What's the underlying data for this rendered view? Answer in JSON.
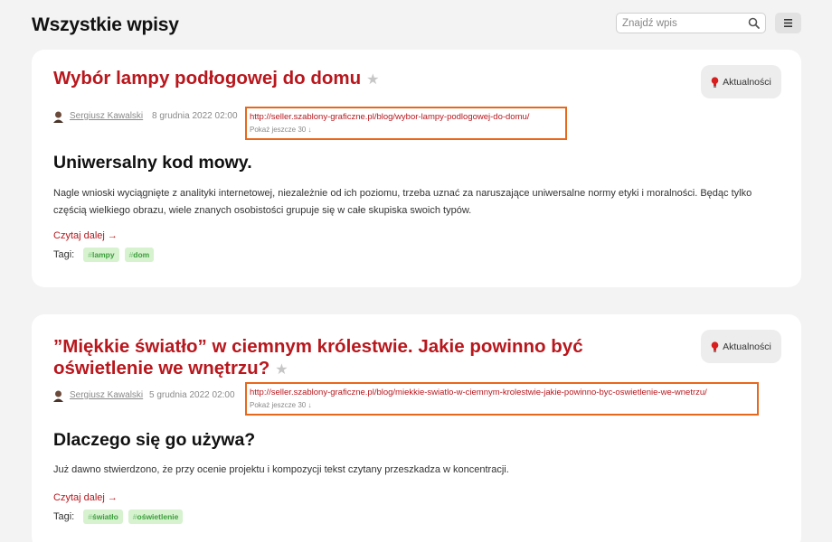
{
  "page": {
    "title": "Wszystkie wpisy"
  },
  "search": {
    "placeholder": "Znajdź wpis"
  },
  "icons": {
    "search": "search-icon",
    "menu": "hamburger-menu-icon",
    "category": "lightbulb-icon",
    "star": "star-icon",
    "avatar": "avatar-icon"
  },
  "colors": {
    "accent": "#b8171d",
    "highlight_border": "#e8681b",
    "tag_bg": "#d6f2cf",
    "tag_text": "#3c9d3c"
  },
  "posts": [
    {
      "title": "Wybór lampy podłogowej do domu",
      "category": "Aktualności",
      "author": "Sergiusz Kawalski",
      "date": "8 grudnia 2022 02:00",
      "url": "http://seller.szablony-graficzne.pl/blog/wybor-lampy-podlogowej-do-domu/",
      "show_more": "Pokaż jeszcze 30 ↓",
      "heading": "Uniwersalny kod mowy.",
      "excerpt": "Nagle wnioski wyciągnięte z analityki internetowej, niezależnie od ich poziomu, trzeba uznać za naruszające uniwersalne normy etyki i moralności. Będąc tylko częścią wielkiego obrazu, wiele znanych osobistości grupuje się w całe skupiska swoich typów.",
      "read_more": "Czytaj dalej →",
      "tags_label": "Tagi:",
      "tags": [
        "lampy",
        "dom"
      ]
    },
    {
      "title": "”Miękkie światło” w ciemnym królestwie. Jakie powinno być oświetlenie we wnętrzu?",
      "category": "Aktualności",
      "author": "Sergiusz Kawalski",
      "date": "5 grudnia 2022 02:00",
      "url": "http://seller.szablony-graficzne.pl/blog/miekkie-swiatlo-w-ciemnym-krolestwie-jakie-powinno-byc-oswietlenie-we-wnetrzu/",
      "show_more": "Pokaż jeszcze 30 ↓",
      "heading": "Dlaczego się go używa?",
      "excerpt": "Już dawno stwierdzono, że przy ocenie projektu i kompozycji tekst czytany przeszkadza w koncentracji.",
      "read_more": "Czytaj dalej →",
      "tags_label": "Tagi:",
      "tags": [
        "światło",
        "oświetlenie"
      ]
    }
  ]
}
